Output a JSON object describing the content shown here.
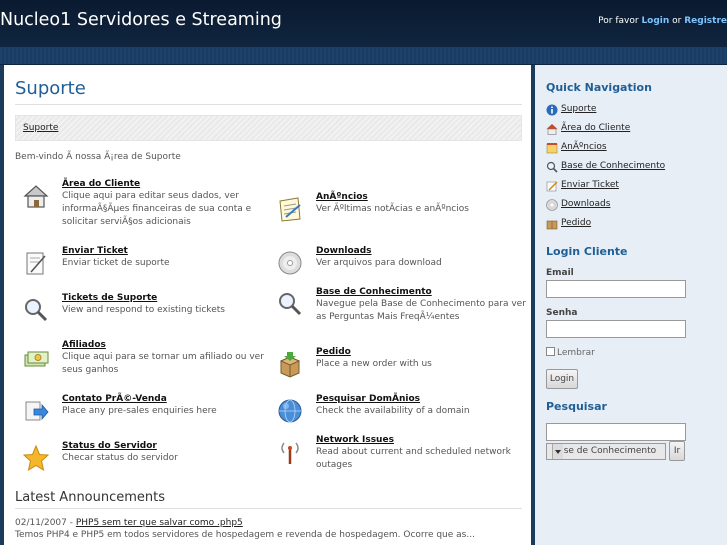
{
  "header": {
    "site_title": "Nucleo1 Servidores e Streaming",
    "prefix": "Por favor ",
    "login_link": "Login",
    "or": " or ",
    "register_link": "Registre"
  },
  "main": {
    "title": "Suporte",
    "breadcrumb": "Suporte",
    "welcome": "Bem-vindo Ã  nossa Ã¡rea de Suporte",
    "items": [
      {
        "label": "Ãrea do Cliente",
        "desc": "Clique aqui para editar seus dados, ver informaÃ§Ãµes financeiras de sua conta e solicitar serviÃ§os adicionais",
        "icon": "house-icon"
      },
      {
        "label": "AnÃºncios",
        "desc": "Ver Ãºltimas notÃ­cias e anÃºncios",
        "icon": "notepad-icon"
      },
      {
        "label": "Enviar Ticket",
        "desc": "Enviar ticket de suporte",
        "icon": "pen-paper-icon"
      },
      {
        "label": "Downloads",
        "desc": "Ver arquivos para download",
        "icon": "disc-icon"
      },
      {
        "label": "Tickets de Suporte",
        "desc": "View and respond to existing tickets",
        "icon": "magnifier-icon"
      },
      {
        "label": "Base de Conhecimento",
        "desc": "Navegue pela Base de Conhecimento para ver as Perguntas Mais FreqÃ¼entes",
        "icon": "magnifier-icon"
      },
      {
        "label": "Afiliados",
        "desc": "Clique aqui para se tornar um afiliado ou ver seus ganhos",
        "icon": "money-icon"
      },
      {
        "label": "Pedido",
        "desc": "Place a new order with us",
        "icon": "package-icon"
      },
      {
        "label": "Contato PrÃ©-Venda",
        "desc": "Place any pre-sales enquiries here",
        "icon": "arrow-icon"
      },
      {
        "label": "Pesquisar DomÃ­nios",
        "desc": "Check the availability of a domain",
        "icon": "globe-icon"
      },
      {
        "label": "Status do Servidor",
        "desc": "Checar status do servidor",
        "icon": "star-icon"
      },
      {
        "label": "Network Issues",
        "desc": "Read about current and scheduled network outages",
        "icon": "antenna-icon"
      }
    ],
    "announcements_heading": "Latest Announcements",
    "ann_date": "02/11/2007 - ",
    "ann_title": "PHP5 sem ter que salvar como .php5",
    "ann_body": "Temos PHP4 e PHP5 em todos servidores de hospedagem e revenda de hospedagem. Ocorre que as..."
  },
  "sidebar": {
    "quick_nav_heading": "Quick Navigation",
    "quick_nav": [
      {
        "label": "Suporte",
        "icon": "info-icon"
      },
      {
        "label": "Ãrea do Cliente",
        "icon": "house-icon"
      },
      {
        "label": "AnÃºncios",
        "icon": "notepad-icon"
      },
      {
        "label": "Base de Conhecimento",
        "icon": "magnifier-icon"
      },
      {
        "label": "Enviar Ticket",
        "icon": "pen-paper-icon"
      },
      {
        "label": "Downloads",
        "icon": "disc-icon"
      },
      {
        "label": "Pedido",
        "icon": "package-icon"
      }
    ],
    "login_heading": "Login Cliente",
    "email_label": "Email",
    "password_label": "Senha",
    "remember_label": "Lembrar",
    "login_button": "Login",
    "search_heading": "Pesquisar",
    "search_select": "Base de Conhecimento",
    "search_button": "Ir"
  }
}
